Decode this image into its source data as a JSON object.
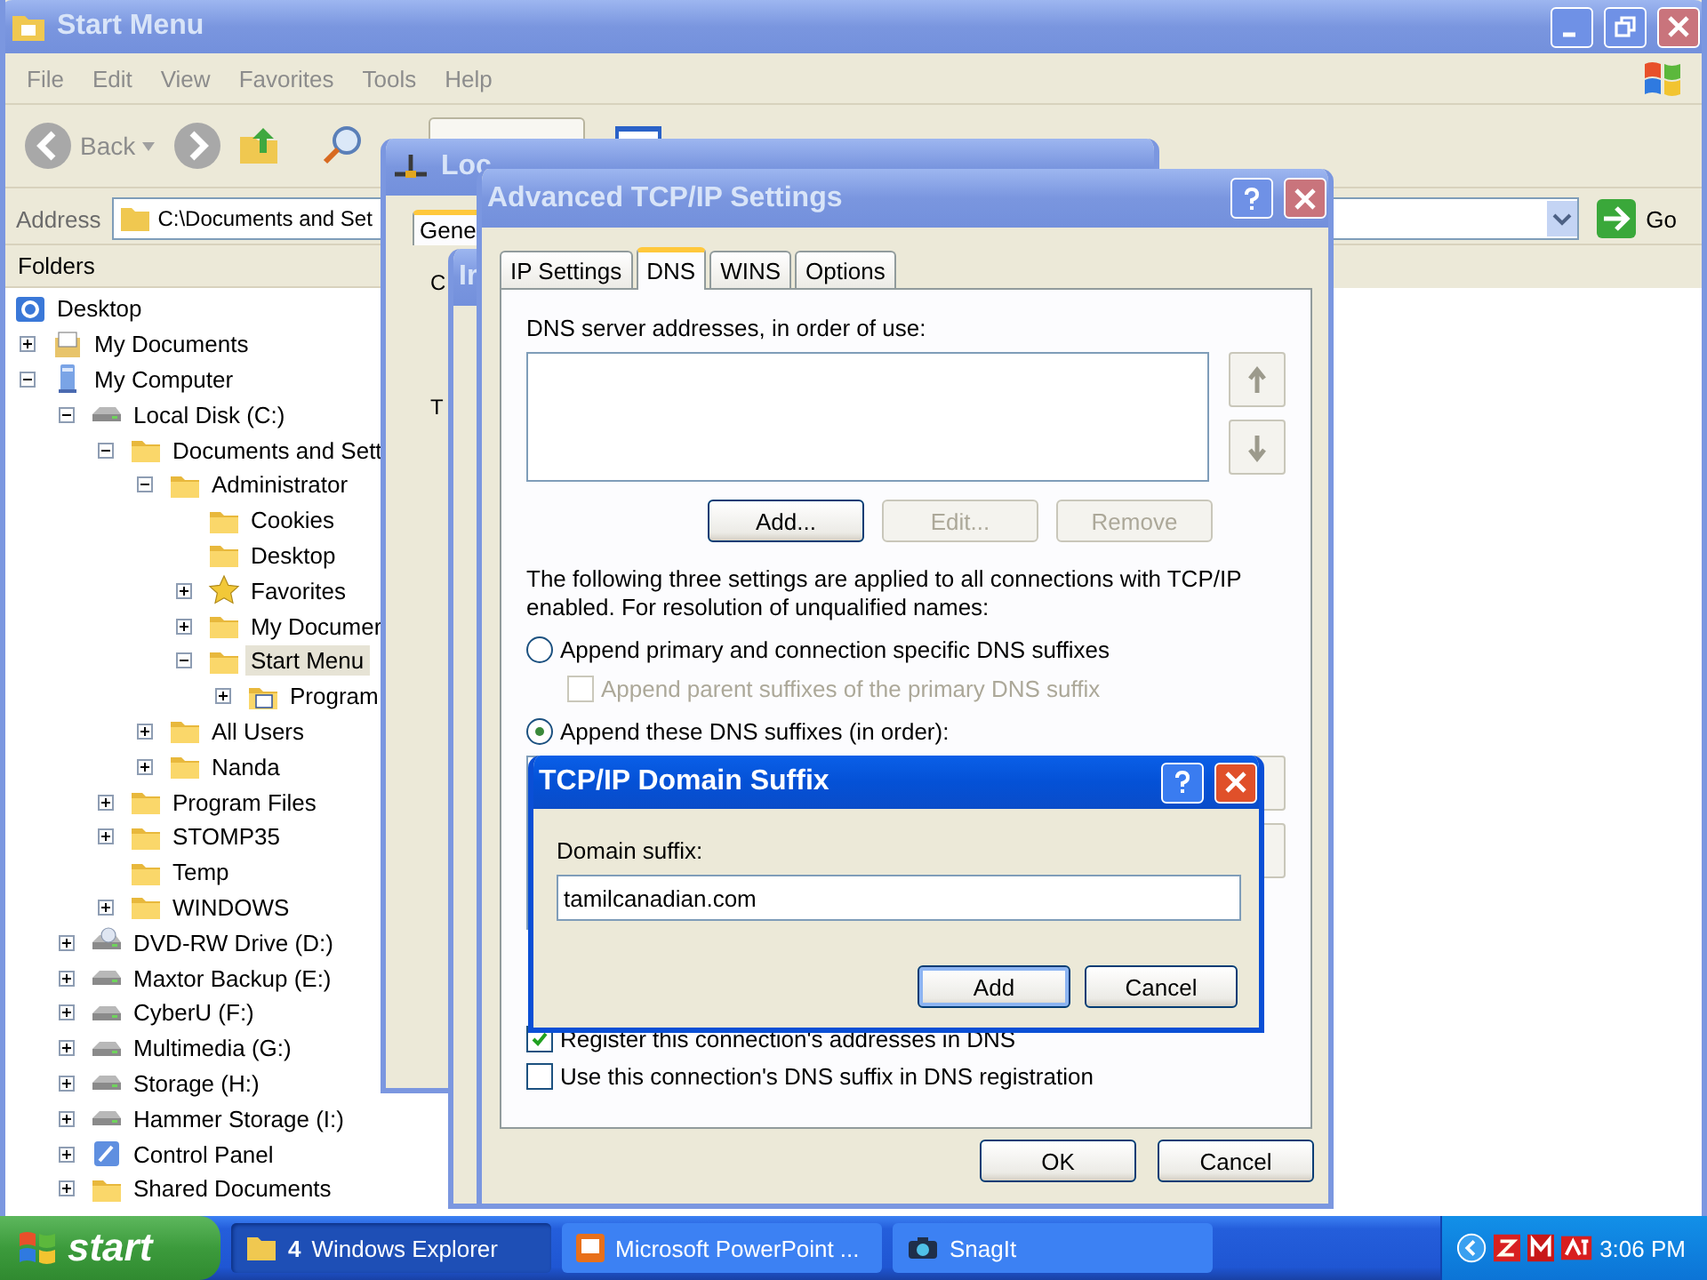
{
  "explorer": {
    "title": "Start Menu",
    "menu": [
      "File",
      "Edit",
      "View",
      "Favorites",
      "Tools",
      "Help"
    ],
    "back_label": "Back",
    "address_label": "Address",
    "address_value": "C:\\Documents and Set",
    "go_label": "Go",
    "folders_title": "Folders",
    "tree": [
      {
        "label": "Desktop",
        "kind": "desktop",
        "selected": false,
        "children": [
          {
            "label": "My Documents",
            "kind": "documents",
            "expanded": false,
            "selected": false
          },
          {
            "label": "My Computer",
            "kind": "computer",
            "expanded": true,
            "selected": false,
            "children": [
              {
                "label": "Local Disk (C:)",
                "kind": "drive",
                "expanded": true,
                "selected": false,
                "children": [
                  {
                    "label": "Documents and Sett",
                    "kind": "folder",
                    "expanded": true,
                    "selected": false,
                    "children": [
                      {
                        "label": "Administrator",
                        "kind": "folder",
                        "expanded": true,
                        "selected": false,
                        "children": [
                          {
                            "label": "Cookies",
                            "kind": "folder",
                            "selected": false
                          },
                          {
                            "label": "Desktop",
                            "kind": "folder",
                            "selected": false
                          },
                          {
                            "label": "Favorites",
                            "kind": "star",
                            "expanded": false,
                            "selected": false
                          },
                          {
                            "label": "My Documer",
                            "kind": "folder",
                            "expanded": false,
                            "selected": false
                          },
                          {
                            "label": "Start Menu",
                            "kind": "folder",
                            "expanded": true,
                            "selected": true,
                            "children": [
                              {
                                "label": "Program",
                                "kind": "programs",
                                "expanded": false,
                                "selected": false
                              }
                            ]
                          }
                        ]
                      },
                      {
                        "label": "All Users",
                        "kind": "folder",
                        "expanded": false,
                        "selected": false
                      },
                      {
                        "label": "Nanda",
                        "kind": "folder",
                        "expanded": false,
                        "selected": false
                      }
                    ]
                  },
                  {
                    "label": "Program Files",
                    "kind": "folder",
                    "expanded": false,
                    "selected": false
                  },
                  {
                    "label": "STOMP35",
                    "kind": "folder",
                    "expanded": false,
                    "selected": false
                  },
                  {
                    "label": "Temp",
                    "kind": "folder",
                    "selected": false
                  },
                  {
                    "label": "WINDOWS",
                    "kind": "folder",
                    "expanded": false,
                    "selected": false
                  }
                ]
              },
              {
                "label": "DVD-RW Drive (D:)",
                "kind": "dvd",
                "expanded": false,
                "selected": false
              },
              {
                "label": "Maxtor Backup (E:)",
                "kind": "drive",
                "expanded": false,
                "selected": false
              },
              {
                "label": "CyberU (F:)",
                "kind": "drive",
                "expanded": false,
                "selected": false
              },
              {
                "label": "Multimedia (G:)",
                "kind": "drive",
                "expanded": false,
                "selected": false
              },
              {
                "label": "Storage (H:)",
                "kind": "drive",
                "expanded": false,
                "selected": false
              },
              {
                "label": "Hammer Storage (I:)",
                "kind": "drive",
                "expanded": false,
                "selected": false
              },
              {
                "label": "Control Panel",
                "kind": "control",
                "expanded": false,
                "selected": false
              },
              {
                "label": "Shared Documents",
                "kind": "folder",
                "expanded": false,
                "selected": false
              }
            ]
          }
        ]
      }
    ]
  },
  "connection_dialog": {
    "title": "Loc",
    "tab": "Gene",
    "labels": [
      "C",
      "T"
    ]
  },
  "protocol_dialog": {
    "title": "Ir"
  },
  "advanced_dialog": {
    "title": "Advanced TCP/IP Settings",
    "tabs": [
      {
        "label": "IP Settings",
        "selected": false
      },
      {
        "label": "DNS",
        "selected": true
      },
      {
        "label": "WINS",
        "selected": false
      },
      {
        "label": "Options",
        "selected": false
      }
    ],
    "servers_label": "DNS server addresses, in order of use:",
    "server_buttons": [
      {
        "label": "Add...",
        "disabled": false
      },
      {
        "label": "Edit...",
        "disabled": true
      },
      {
        "label": "Remove",
        "disabled": true
      }
    ],
    "description": "The following three settings are applied to all connections with TCP/IP enabled. For resolution of unqualified names:",
    "options": [
      {
        "kind": "radio",
        "label": "Append primary and connection specific DNS suffixes",
        "selected": false,
        "disabled": false
      },
      {
        "kind": "checkbox",
        "label": "Append parent suffixes of the primary DNS suffix",
        "checked": false,
        "disabled": true
      },
      {
        "kind": "radio",
        "label": "Append these DNS suffixes (in order):",
        "selected": true,
        "disabled": false
      }
    ],
    "registration": [
      {
        "label": "Register this connection's addresses in DNS",
        "checked": true
      },
      {
        "label": "Use this connection's DNS suffix in DNS registration",
        "checked": false
      }
    ],
    "buttons": [
      "OK",
      "Cancel"
    ]
  },
  "suffix_dialog": {
    "title": "TCP/IP Domain Suffix",
    "field_label": "Domain suffix:",
    "value": "tamilcanadian.com",
    "buttons": [
      "Add",
      "Cancel"
    ]
  },
  "taskbar": {
    "start": "start",
    "tasks": [
      {
        "count": "4",
        "label": "Windows Explorer",
        "selected": true
      },
      {
        "label": "Microsoft PowerPoint ...",
        "selected": false
      },
      {
        "label": "SnagIt",
        "selected": false
      }
    ],
    "time": "3:06 PM"
  }
}
